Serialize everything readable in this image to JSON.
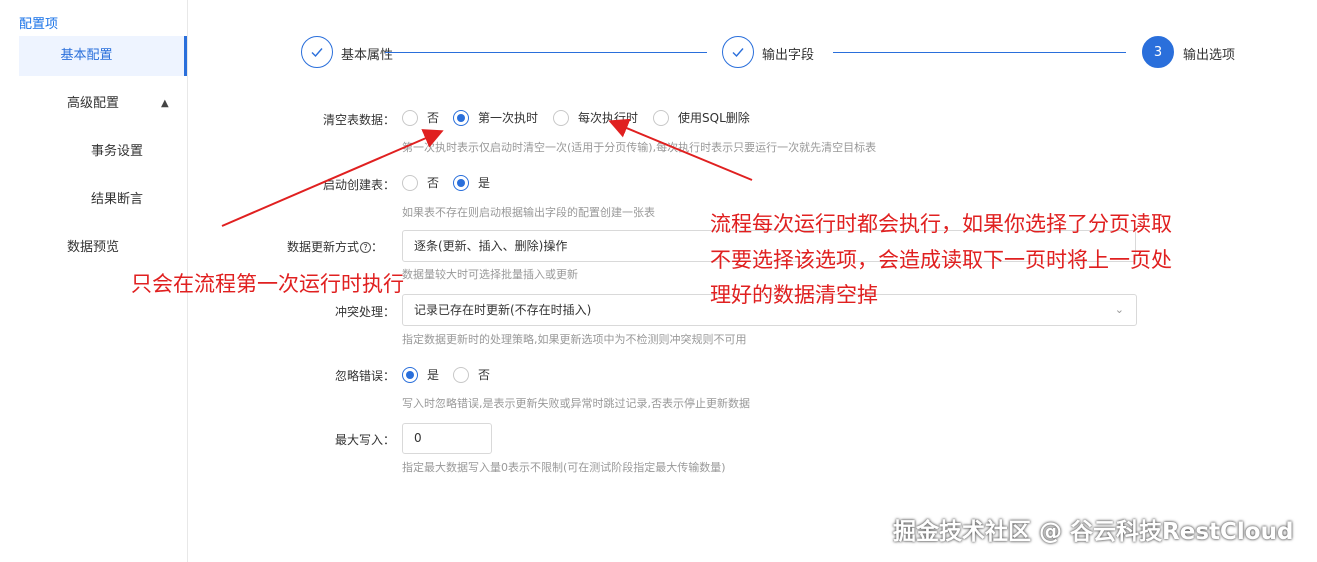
{
  "sidebar": {
    "title": "配置项",
    "items": [
      {
        "label": "基本配置",
        "active": true
      },
      {
        "label": "高级配置",
        "expanded": true
      },
      {
        "label": "事务设置"
      },
      {
        "label": "结果断言"
      },
      {
        "label": "数据预览"
      }
    ],
    "caret_icon": "chevron-up-icon"
  },
  "steps": [
    {
      "label": "基本属性",
      "status": "done"
    },
    {
      "label": "输出字段",
      "status": "done"
    },
    {
      "label": "输出选项",
      "status": "current",
      "number": "3"
    }
  ],
  "form": {
    "clear_table": {
      "label": "清空表数据：",
      "options": [
        "否",
        "第一次执时",
        "每次执行时",
        "使用SQL删除"
      ],
      "selected": "第一次执时",
      "hint": "第一次执时表示仅启动时清空一次(适用于分页传输),每次执行时表示只要运行一次就先清空目标表"
    },
    "auto_create": {
      "label": "启动创建表：",
      "options": [
        "否",
        "是"
      ],
      "selected": "是",
      "hint": "如果表不存在则启动根据输出字段的配置创建一张表"
    },
    "update_mode": {
      "label": "数据更新方式",
      "help_icon": "question-circle-icon",
      "value": "逐条(更新、插入、删除)操作",
      "hint": "数据量较大时可选择批量插入或更新"
    },
    "conflict": {
      "label": "冲突处理：",
      "value": "记录已存在时更新(不存在时插入)",
      "hint": "指定数据更新时的处理策略,如果更新选项中为不检测则冲突规则不可用"
    },
    "ignore_errors": {
      "label": "忽略错误：",
      "options": [
        "是",
        "否"
      ],
      "selected": "是",
      "hint": "写入时忽略错误,是表示更新失败或异常时跳过记录,否表示停止更新数据"
    },
    "max_write": {
      "label": "最大写入：",
      "value": "0",
      "hint": "指定最大数据写入量0表示不限制(可在测试阶段指定最大传输数量)"
    }
  },
  "annotations": {
    "left_note": "只会在流程第一次运行时执行",
    "right_note_lines": [
      "流程每次运行时都会执行，如果你选择了分页读取",
      "不要选择该选项，会造成读取下一页时将上一页处",
      "理好的数据清空掉"
    ],
    "color": "#e02020"
  },
  "watermark": "掘金技术社区 @ 谷云科技RestCloud",
  "colors": {
    "accent": "#2a6fdb",
    "hint": "#999999",
    "annotation": "#e02020"
  }
}
